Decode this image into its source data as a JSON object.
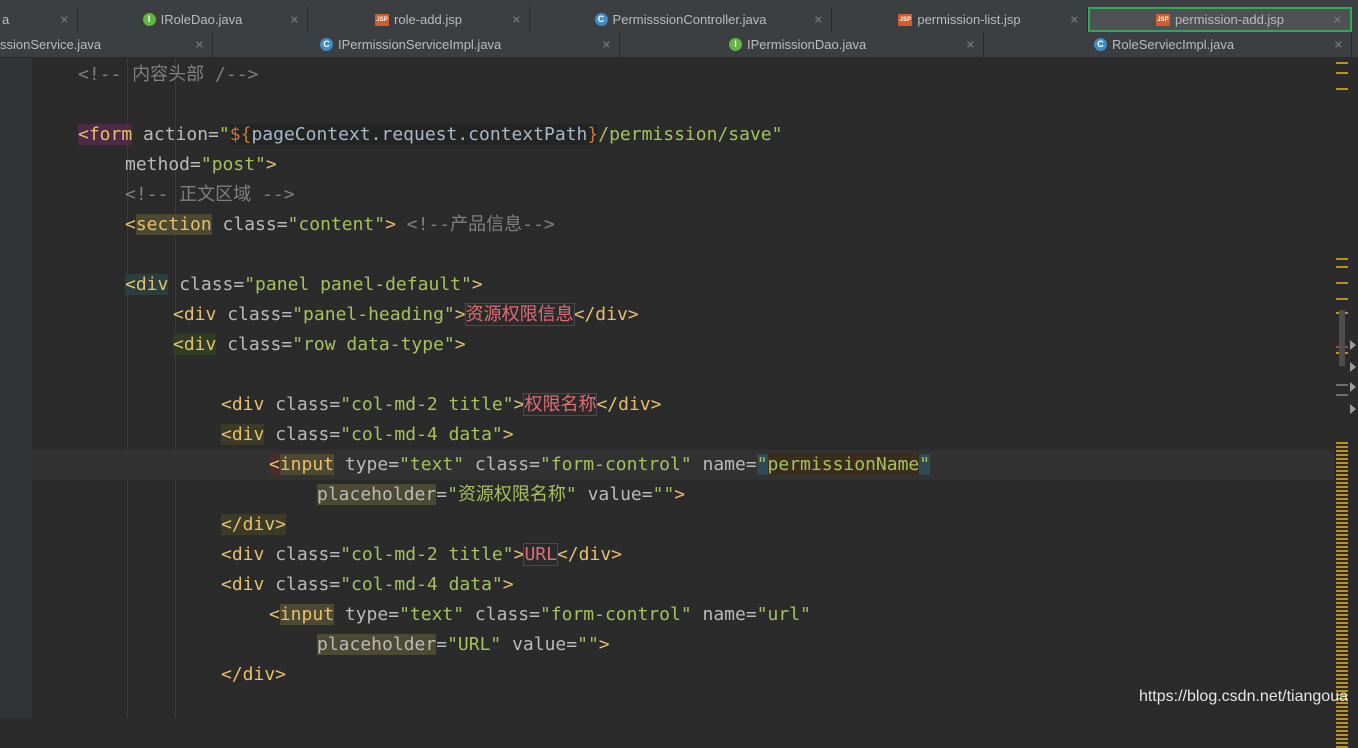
{
  "tabs_row0": [
    {
      "label": "a",
      "icon": "class-icon",
      "icon_text": "",
      "active": false
    },
    {
      "label": "IRoleDao.java",
      "icon": "interface-icon",
      "icon_text": "I",
      "active": false
    },
    {
      "label": "role-add.jsp",
      "icon": "jsp-icon",
      "icon_text": "JSP",
      "active": false
    },
    {
      "label": "PermisssionController.java",
      "icon": "class-icon",
      "icon_text": "C",
      "active": false
    },
    {
      "label": "permission-list.jsp",
      "icon": "jsp-icon",
      "icon_text": "JSP",
      "active": false
    },
    {
      "label": "permission-add.jsp",
      "icon": "jsp-icon",
      "icon_text": "JSP",
      "active": true
    }
  ],
  "tabs_row1": [
    {
      "label": "ssionService.java",
      "icon": "",
      "icon_text": ""
    },
    {
      "label": "IPermissionServiceImpl.java",
      "icon": "class-icon",
      "icon_text": "C"
    },
    {
      "label": "IPermissionDao.java",
      "icon": "interface-icon",
      "icon_text": "I"
    },
    {
      "label": "RoleServiecImpl.java",
      "icon": "class-icon",
      "icon_text": "C"
    }
  ],
  "code": {
    "l1_comment": "<!-- 内容头部 /-->",
    "l3_open": "<",
    "l3_tag": "form",
    "l3_attr": " action=",
    "l3_q1": "\"",
    "l3_expr_open": "${",
    "l3_expr": "pageContext.request.contextPath",
    "l3_expr_close": "}",
    "l3_val": "/permission/save\"",
    "l4_attr": "method=",
    "l4_val": "\"post\"",
    "l4_close": ">",
    "l5_comment": "<!-- 正文区域 -->",
    "l6_open": "<",
    "l6_tag": "section",
    "l6_attr": " class=",
    "l6_val": "\"content\"",
    "l6_close": "> ",
    "l6_comment": "<!--产品信息-->",
    "l8_open": "<",
    "l8_tag": "div",
    "l8_attr": " class=",
    "l8_val": "\"panel panel-default\"",
    "l8_close": ">",
    "l9_open": "<",
    "l9_tag": "div",
    "l9_attr": " class=",
    "l9_val": "\"panel-heading\"",
    "l9_gt": ">",
    "l9_text": "资源权限信息",
    "l9_end": "</div>",
    "l10_open": "<",
    "l10_tag": "div",
    "l10_attr": " class=",
    "l10_val": "\"row data-type\"",
    "l10_close": ">",
    "l12_open": "<div",
    "l12_attr": " class=",
    "l12_val": "\"col-md-2 title\"",
    "l12_gt": ">",
    "l12_text": "权限名称",
    "l12_end": "</div>",
    "l13_open": "<div",
    "l13_attr": " class=",
    "l13_val": "\"col-md-4 data\"",
    "l13_close": ">",
    "l14_open": "<",
    "l14_tag": "input",
    "l14_attr1": " type=",
    "l14_val1": "\"text\"",
    "l14_attr2": " class=",
    "l14_val2": "\"form-control\"",
    "l14_attr3": " name=",
    "l14_q": "\"",
    "l14_val3": "permissionName",
    "l14_q2": "\"",
    "l15_attr1": "placeholder",
    "l15_eq": "=",
    "l15_val1": "\"资源权限名称\"",
    "l15_attr2": " value=",
    "l15_val2": "\"\"",
    "l15_close": ">",
    "l16_end": "</div>",
    "l17_open": "<div",
    "l17_attr": " class=",
    "l17_val": "\"col-md-2 title\"",
    "l17_gt": ">",
    "l17_text": "URL",
    "l17_end": "</div>",
    "l18_open": "<div",
    "l18_attr": " class=",
    "l18_val": "\"col-md-4 data\"",
    "l18_close": ">",
    "l19_open": "<",
    "l19_tag": "input",
    "l19_attr1": " type=",
    "l19_val1": "\"text\"",
    "l19_attr2": " class=",
    "l19_val2": "\"form-control\"",
    "l19_attr3": " name=",
    "l19_val3": "\"url\"",
    "l20_attr1": "placeholder",
    "l20_eq": "=",
    "l20_val1": "\"URL\"",
    "l20_attr2": " value=",
    "l20_val2": "\"\"",
    "l20_close": ">",
    "l21_end": "</div>"
  },
  "watermark": "https://blog.csdn.net/tiangoua",
  "colors": {
    "background": "#2b2b2b",
    "tag": "#e8bf6a",
    "string": "#a5c25c",
    "comment": "#808080",
    "active_tab_border": "#31a75a"
  }
}
